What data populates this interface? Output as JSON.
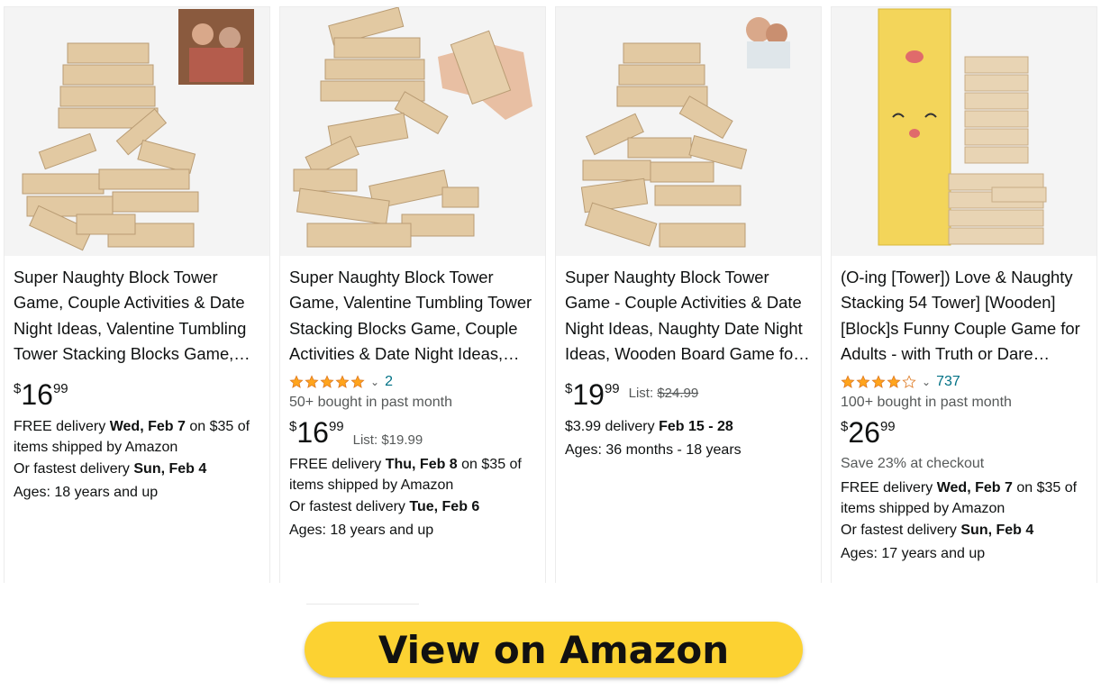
{
  "colors": {
    "star": "#ffa41c",
    "link": "#007185",
    "cta": "#fcd232"
  },
  "products": [
    {
      "title": "Super Naughty Block Tower Game, Couple Activities & Date Night Ideas, Valentine Tumbling Tower Stacking Blocks Game, Couple Activities & Date Night Ideas, Valentine Gift for Him Her",
      "rating": null,
      "rating_count": "",
      "bought": "",
      "price": {
        "symbol": "$",
        "whole": "16",
        "fraction": "99"
      },
      "list_label": "",
      "list_price": "",
      "save": "",
      "delivery_prefix": "FREE delivery ",
      "delivery_date": "Wed, Feb 7",
      "delivery_suffix": " on $35 of items shipped by Amazon",
      "fastest_prefix": "Or fastest delivery ",
      "fastest_date": "Sun, Feb 4",
      "ages": "Ages: 18 years and up",
      "image_icon": "tumbling-tower-blocks-image"
    },
    {
      "title": "Super Naughty Block Tower Game, Valentine Tumbling Tower Stacking Blocks Game, Couple Activities & Date Night Ideas, Valentine Gift",
      "rating": 5,
      "rating_count": "2",
      "bought": "50+ bought in past month",
      "price": {
        "symbol": "$",
        "whole": "16",
        "fraction": "99"
      },
      "list_label": "List: ",
      "list_price": "$19.99",
      "list_strike": false,
      "save": "",
      "delivery_prefix": "FREE delivery ",
      "delivery_date": "Thu, Feb 8",
      "delivery_suffix": " on $35 of items shipped by Amazon",
      "fastest_prefix": "Or fastest delivery ",
      "fastest_date": "Tue, Feb 6",
      "ages": "Ages: 18 years and up",
      "image_icon": "tumbling-tower-blocks-image"
    },
    {
      "title": "Super Naughty Block Tower Game - Couple Activities & Date Night Ideas, Naughty Date Night Ideas, Wooden Board Game for Couples",
      "rating": null,
      "rating_count": "",
      "bought": "",
      "price": {
        "symbol": "$",
        "whole": "19",
        "fraction": "99"
      },
      "list_label": "List: ",
      "list_price": "$24.99",
      "list_strike": true,
      "save": "",
      "delivery_prefix": "$3.99 delivery ",
      "delivery_date": "Feb 15 - 28",
      "delivery_suffix": "",
      "fastest_prefix": "",
      "fastest_date": "",
      "ages": "Ages: 36 months - 18 years",
      "image_icon": "tumbling-tower-blocks-image"
    },
    {
      "title": "(O-ing [Tower]) Love & Naughty Stacking 54 Tower] [Wooden] [Block]s Funny Couple Game for Adults - with Truth or Dare Questions",
      "rating": 4,
      "rating_count": "737",
      "bought": "100+ bought in past month",
      "price": {
        "symbol": "$",
        "whole": "26",
        "fraction": "99"
      },
      "list_label": "",
      "list_price": "",
      "save": "Save 23% at checkout",
      "delivery_prefix": "FREE delivery ",
      "delivery_date": "Wed, Feb 7",
      "delivery_suffix": " on $35 of items shipped by Amazon",
      "fastest_prefix": "Or fastest delivery ",
      "fastest_date": "Sun, Feb 4",
      "ages": "Ages: 17 years and up",
      "image_icon": "boxed-tower-game-image"
    }
  ],
  "cta": {
    "label": "View on Amazon"
  }
}
